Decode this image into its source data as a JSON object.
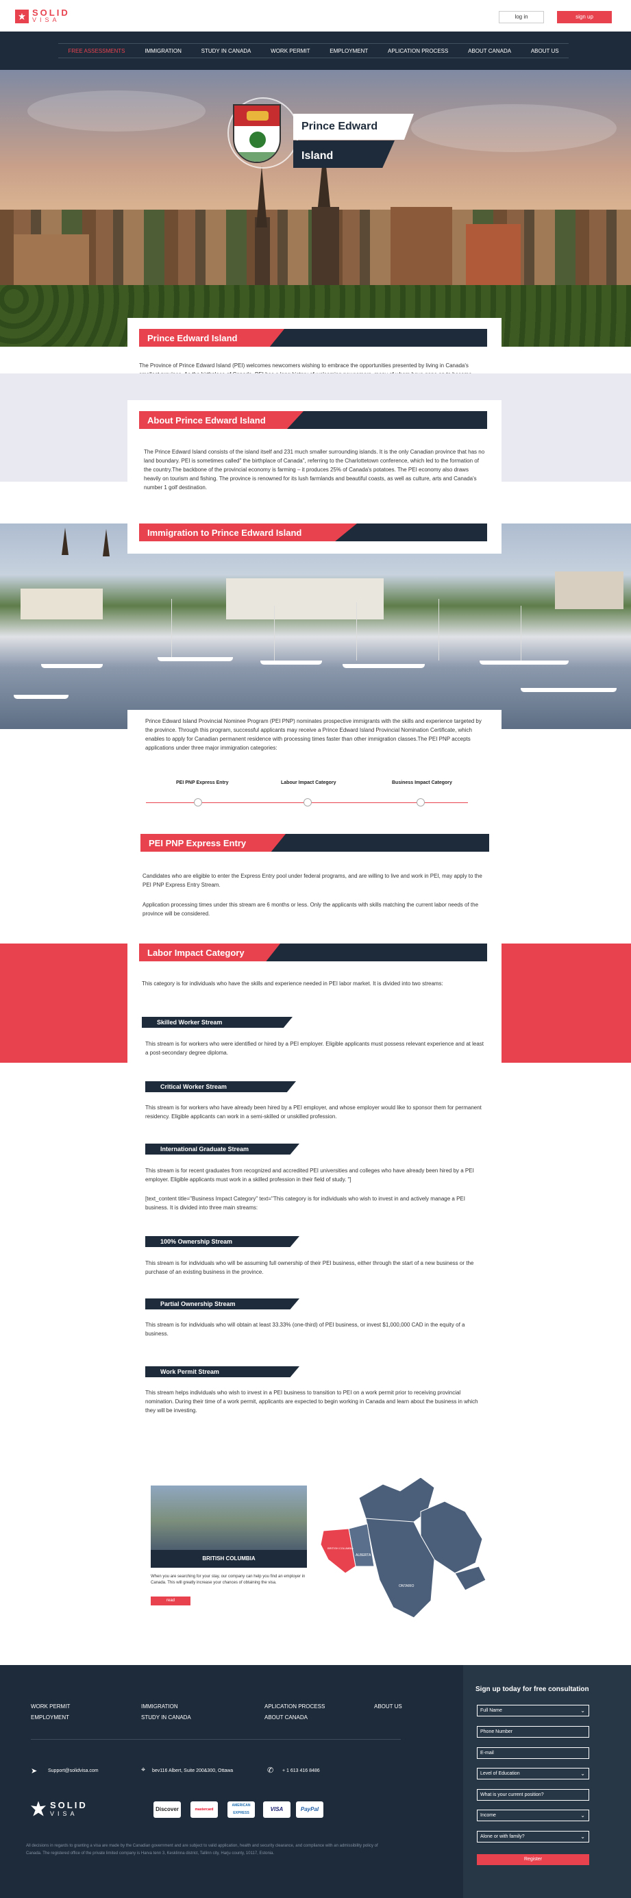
{
  "header": {
    "logo_text_1": "SOLID",
    "logo_text_2": "VISA",
    "login": "log in",
    "signup": "sign up"
  },
  "nav": [
    "FREE ASSESSMENTS",
    "IMMIGRATION",
    "STUDY IN CANADA",
    "WORK PERMIT",
    "EMPLOYMENT",
    "APLICATION PROCESS",
    "ABOUT CANADA",
    "ABOUT US"
  ],
  "hero": {
    "line1": "Prince Edward",
    "line2": "Island"
  },
  "s1": {
    "title": "Prince Edward Island",
    "text": "The Province of Prince Edward Island (PEI) welcomes newcomers wishing to embrace the opportunities presented by living in Canada's smallest province. As the birthplace of Canada, PEI has a long history of welcoming newcomers, many of whom have gone on to become successful entrepreneurs, tradespeople and artisans."
  },
  "s2": {
    "title": "About Prince Edward Island",
    "text": "The Prince Edward Island consists of the island itself and 231 much smaller surrounding islands. It is the only Canadian province that has no land boundary. PEI is sometimes called\" the birthplace of Canada\", referring to the Charlottetown conference, which led to the formation of the country.The backbone of the provincial economy is farming – it produces 25% of Canada's potatoes. The PEI economy also draws heavily on tourism and fishing. The province is renowned for its lush farmlands and beautiful coasts, as well as culture, arts and Canada's number 1 golf destination."
  },
  "s3": {
    "title": "Immigration to Prince Edward Island",
    "text": "Prince Edward Island Provincial Nominee Program (PEI PNP) nominates prospective immigrants with the skills and experience targeted by the province. Through this program, successful applicants may receive a Prince Edward Island Provincial Nomination Certificate, which enables to apply for Canadian permanent residence with processing times faster than other immigration classes.The PEI PNP accepts applications under three major immigration categories:"
  },
  "timeline": [
    "PEI PNP Express Entry",
    "Labour Impact Category",
    "Business Impact Category"
  ],
  "s4": {
    "title": "PEI PNP Express Entry",
    "text1": "Candidates who are eligible to enter the Express Entry pool under federal programs, and are willing to live and work in PEI, may apply to the PEI PNP Express Entry Stream.",
    "text2": "Application processing times under this stream are 6 months or less. Only the applicants with skills matching the current labor needs of the province will be considered."
  },
  "s5": {
    "title": "Labor Impact Category",
    "text": "This category is for individuals who have the skills and experience needed in PEI labor market. It is divided into two streams:"
  },
  "streams": [
    {
      "title": "Skilled Worker Stream",
      "text": "This stream is for workers who were identified or hired by a PEI employer. Eligible applicants must possess relevant experience and at least a post-secondary degree diploma."
    },
    {
      "title": "Critical Worker Stream",
      "text": "This stream is for workers who have already been hired by a PEI employer, and whose employer would like to sponsor them for permanent residency. Eligible applicants can work in a semi-skilled or unskilled profession."
    },
    {
      "title": "International Graduate Stream",
      "text": "This stream is for recent graduates from recognized and accredited PEI universities and colleges who have already been hired by a PEI employer. Eligible applicants must work in a skilled profession in their field of study. \"]",
      "text2": "[text_content title=\"Business Impact Category\" text=\"This category is for individuals who wish to invest in and actively manage a PEI business. It is divided into three main streams:"
    },
    {
      "title": "100% Ownership Stream",
      "text": "This stream is for individuals who will be assuming full ownership of their PEI business, either through the start of a new business or the purchase of an existing business in the province."
    },
    {
      "title": "Partial Ownership Stream",
      "text": "This stream is for individuals who will obtain at least 33.33% (one-third) of PEI business, or invest $1,000,000 CAD in the equity of a business."
    },
    {
      "title": "Work Permit Stream",
      "text": "This stream helps individuals who wish to invest in a PEI business to transition to PEI on a work permit prior to receiving provincial nomination. During their time of a work permit, applicants are expected to begin working in Canada and learn about the business in which they will be investing."
    }
  ],
  "province_card": {
    "label": "BRITISH COLUMBIA",
    "text": "When you are searching for your stay, our company can help you find an employer in Canada. This will greatly increase your chances of obtaining the visa.",
    "button": "read"
  },
  "map_labels": [
    "ALBERTA",
    "ONTARIO",
    "BRITISH COLUMBIA"
  ],
  "footer": {
    "links": [
      "WORK PERMIT",
      "EMPLOYMENT",
      "IMMIGRATION",
      "STUDY IN CANADA",
      "APLICATION PROCESS",
      "ABOUT CANADA",
      "ABOUT US"
    ],
    "email": "Support@solidvisa.com",
    "address": "bev116 Albert, Suite 200&300, Ottawa",
    "phone": "+ 1 613 416 8486",
    "payments": [
      "Discover",
      "mastercard",
      "AMERICAN EXPRESS",
      "VISA",
      "PayPal"
    ],
    "disclaimer": "All decisions in regards to granting a visa are made by the Canadian government and are subject to valid application, health and security clearance, and compliance with an admissibility policy of Canada. The registered office of the private limited company is Harva tenn 3, Kesklinna district, Tallinn city, Harju county, 10117, Estonia."
  },
  "form": {
    "title": "Sign up today for free consultation",
    "fields": [
      "Full Name",
      "Phone Number",
      "E-mail",
      "Level of Education",
      "What is your current position?",
      "Income",
      "Alone or with family?"
    ],
    "submit": "Register"
  },
  "colors": {
    "accent": "#e8424f",
    "navy": "#1e2b3a"
  }
}
